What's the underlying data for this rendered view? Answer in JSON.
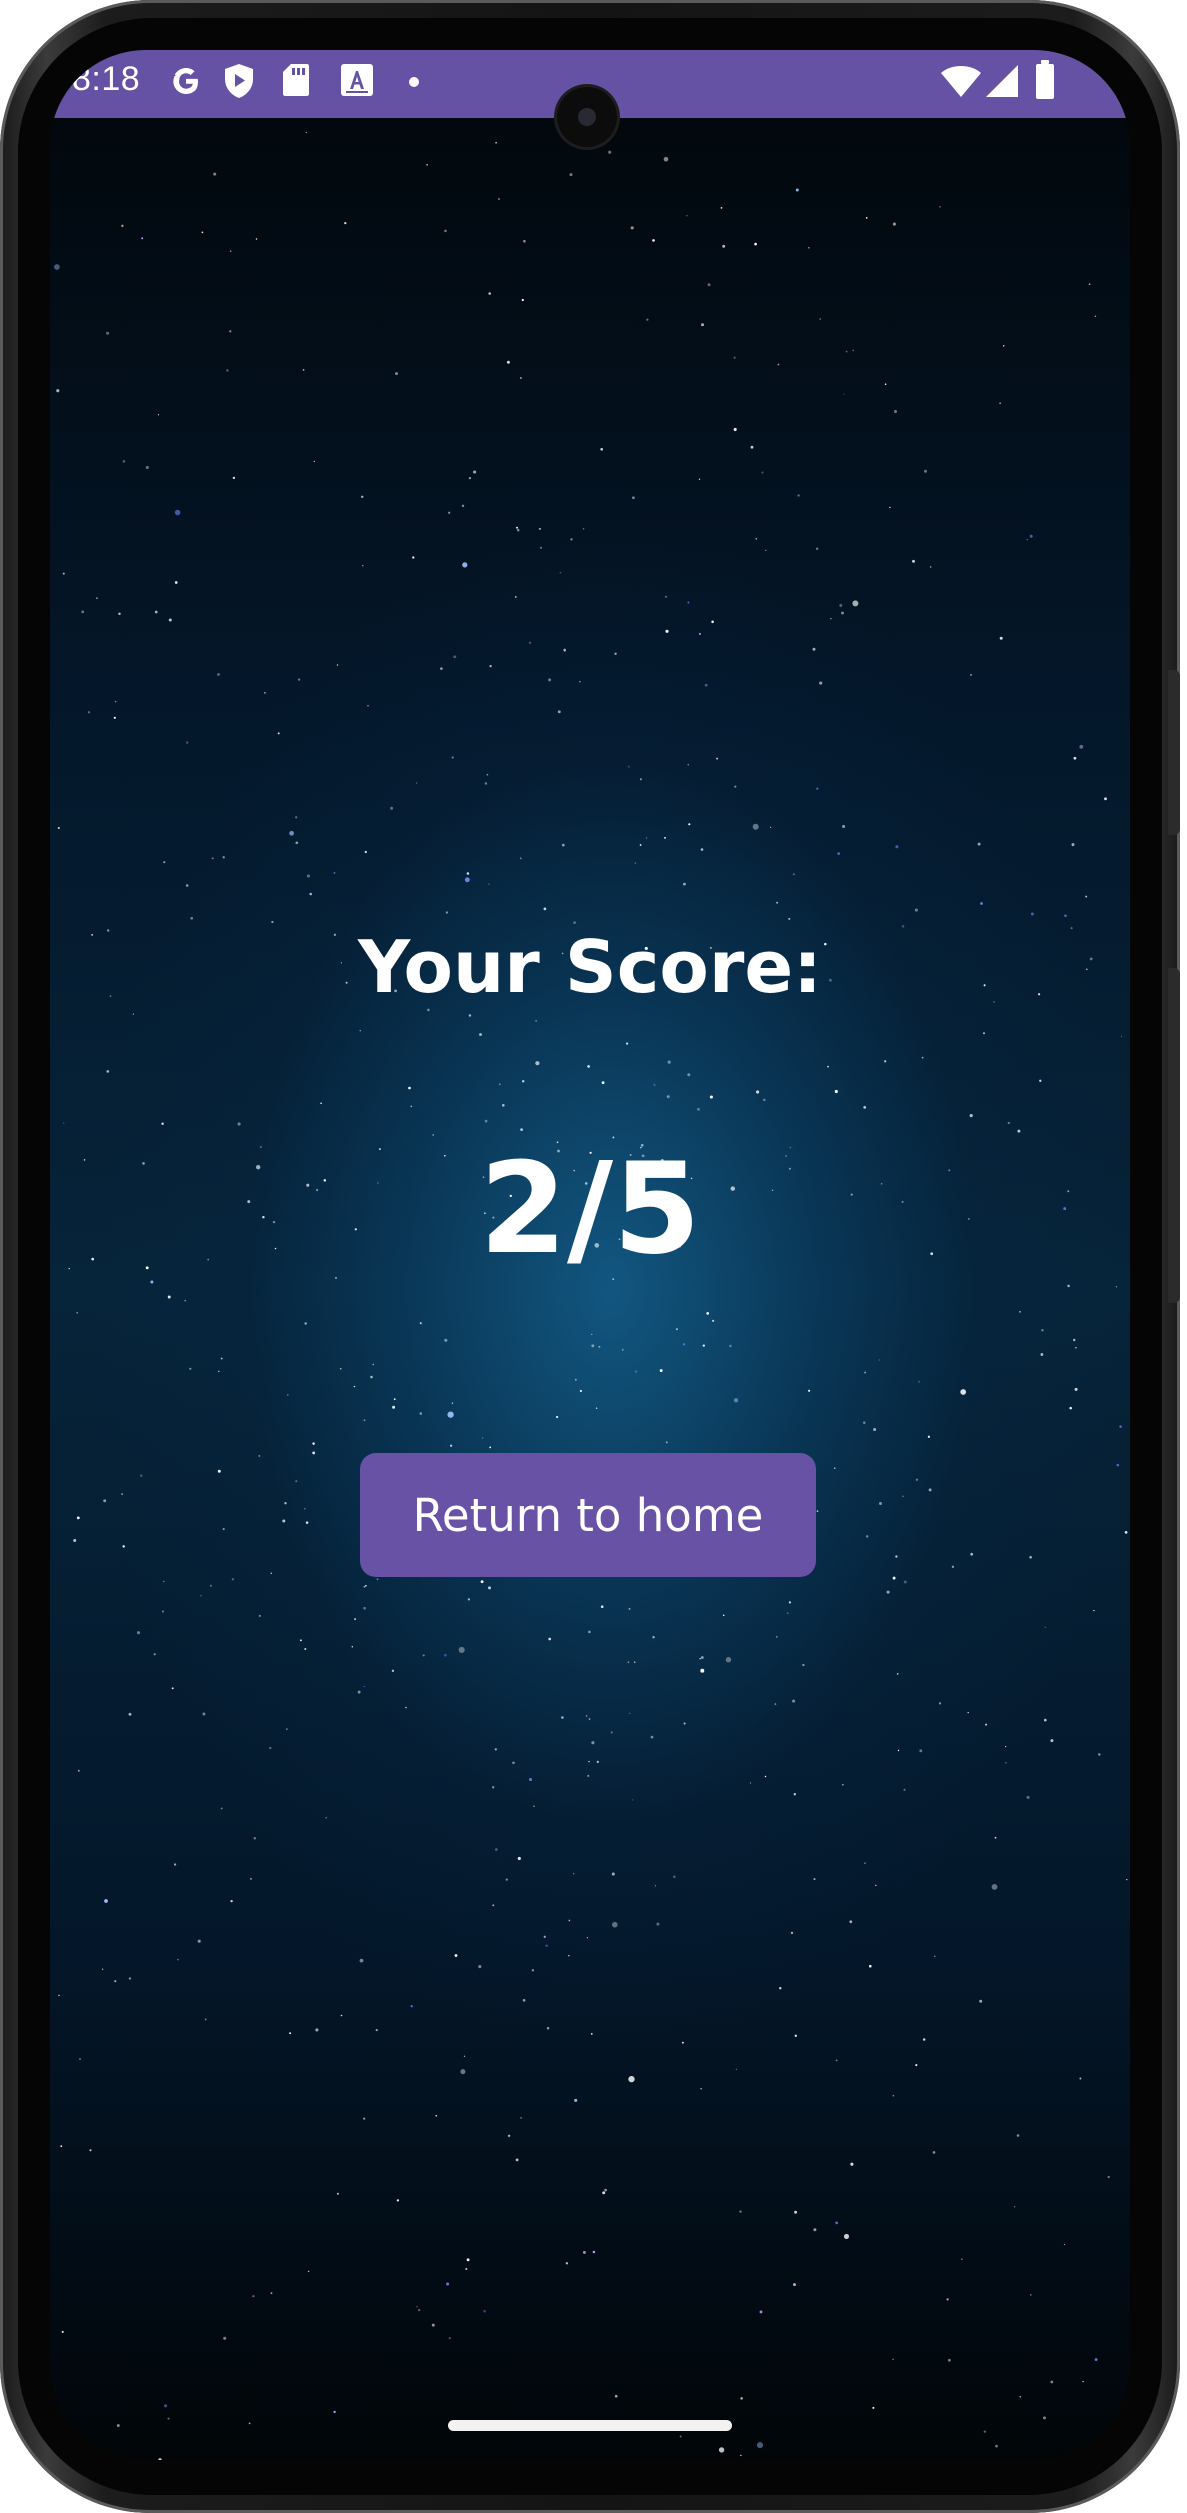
{
  "status_bar": {
    "time": "8:18",
    "icons": [
      "google-icon",
      "shield-play-icon",
      "sd-card-icon",
      "text-a-icon",
      "dot-icon",
      "wifi-icon",
      "signal-icon",
      "battery-icon"
    ],
    "background_color": "#6652a4"
  },
  "score_screen": {
    "title": "Your Score:",
    "score": "2/5"
  },
  "actions": {
    "return_home_label": "Return to home"
  },
  "colors": {
    "accent": "#6852a6",
    "text": "#ffffff"
  }
}
